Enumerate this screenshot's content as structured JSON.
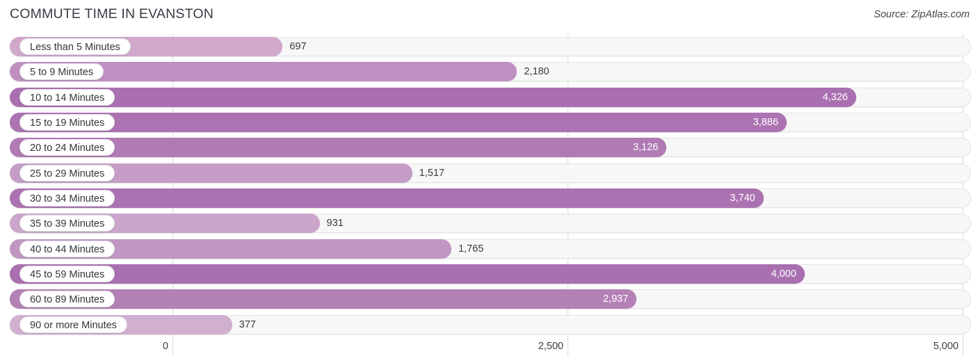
{
  "header": {
    "title": "COMMUTE TIME IN EVANSTON",
    "source": "Source: ZipAtlas.com"
  },
  "chart_data": {
    "type": "bar",
    "orientation": "horizontal",
    "title": "COMMUTE TIME IN EVANSTON",
    "xlabel": "",
    "ylabel": "",
    "xlim": [
      0,
      5000
    ],
    "grid": true,
    "legend": null,
    "xticks": [
      "0",
      "2,500",
      "5,000"
    ],
    "xtick_values": [
      0,
      2500,
      5000
    ],
    "categories": [
      "Less than 5 Minutes",
      "5 to 9 Minutes",
      "10 to 14 Minutes",
      "15 to 19 Minutes",
      "20 to 24 Minutes",
      "25 to 29 Minutes",
      "30 to 34 Minutes",
      "35 to 39 Minutes",
      "40 to 44 Minutes",
      "45 to 59 Minutes",
      "60 to 89 Minutes",
      "90 or more Minutes"
    ],
    "values": [
      697,
      2180,
      4326,
      3886,
      3126,
      1517,
      3740,
      931,
      1765,
      4000,
      2937,
      377
    ],
    "value_labels": [
      "697",
      "2,180",
      "4,326",
      "3,886",
      "3,126",
      "1,517",
      "3,740",
      "931",
      "1,765",
      "4,000",
      "2,937",
      "377"
    ],
    "bar_colors": [
      "#cfa8cc",
      "#bf8fc2",
      "#a96fb0",
      "#ab73b2",
      "#b07ab4",
      "#c59dc7",
      "#ab72b1",
      "#cba6ca",
      "#c096c3",
      "#a970b0",
      "#b481b6",
      "#d0afcf"
    ],
    "track_color": "#f7f7f7",
    "label_pill_color": "#ffffff",
    "gridline_color": "#d9d9dd"
  }
}
